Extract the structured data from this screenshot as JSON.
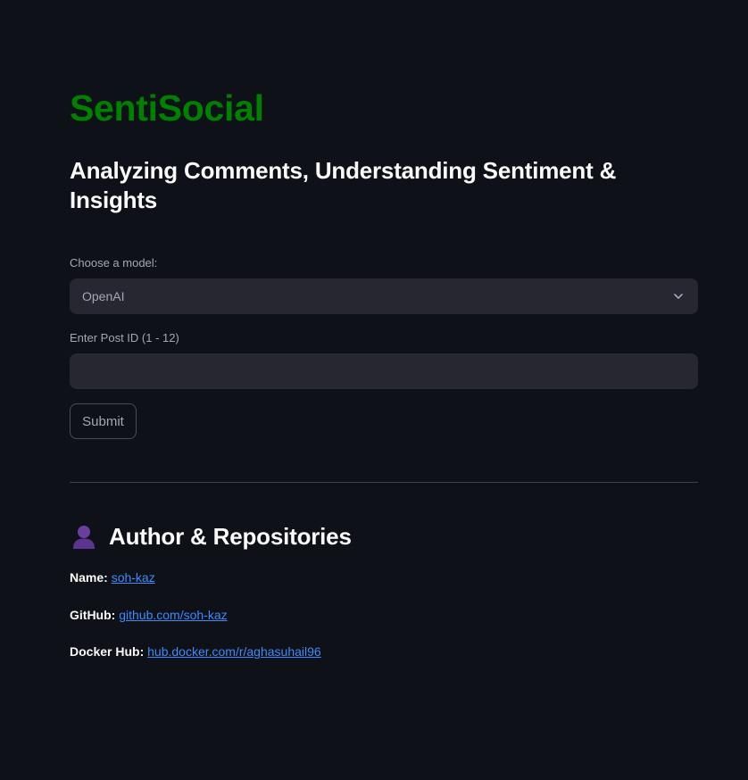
{
  "app": {
    "title": "SentiSocial",
    "subtitle": "Analyzing Comments, Understanding Sentiment & Insights"
  },
  "form": {
    "model_label": "Choose a model:",
    "model_selected": "OpenAI",
    "post_id_label": "Enter Post ID (1 - 12)",
    "post_id_value": "",
    "submit_label": "Submit"
  },
  "author_section": {
    "icon": "person-silhouette-icon",
    "title": "Author & Repositories",
    "items": [
      {
        "key": "Name:",
        "link_text": "soh-kaz"
      },
      {
        "key": "GitHub:",
        "link_text": "github.com/soh-kaz"
      },
      {
        "key": "Docker Hub:",
        "link_text": "hub.docker.com/r/aghasuhail96"
      }
    ]
  },
  "colors": {
    "background": "#0e1117",
    "title_green": "#008000",
    "input_bg": "#262730",
    "link_blue": "#3d8bfd"
  }
}
